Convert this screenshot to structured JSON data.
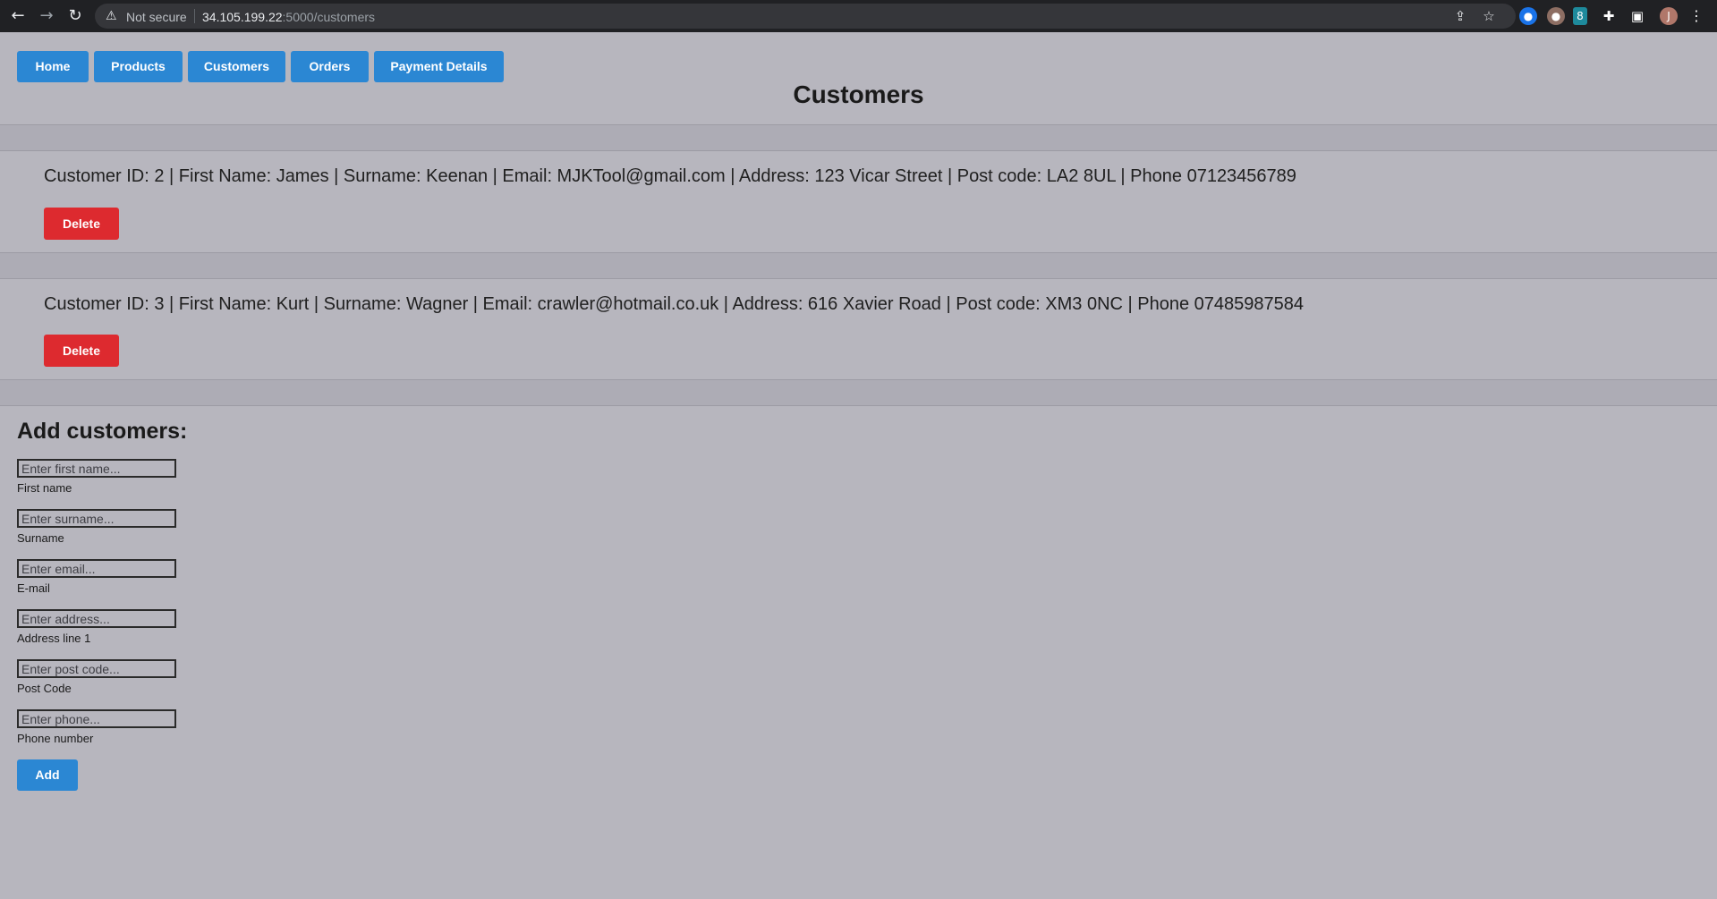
{
  "browser": {
    "security_label": "Not secure",
    "host": "34.105.199.22",
    "path": ":5000/customers",
    "avatar_letter": "J"
  },
  "nav": {
    "home": "Home",
    "products": "Products",
    "customers": "Customers",
    "orders": "Orders",
    "payment_details": "Payment Details"
  },
  "page_title": "Customers",
  "customers": [
    {
      "text": "Customer ID: 2 | First Name: James | Surname: Keenan | Email: MJKTool@gmail.com | Address: 123 Vicar Street | Post code: LA2 8UL | Phone 07123456789",
      "delete_label": "Delete"
    },
    {
      "text": "Customer ID: 3 | First Name: Kurt | Surname: Wagner | Email: crawler@hotmail.co.uk | Address: 616 Xavier Road | Post code: XM3 0NC | Phone 07485987584",
      "delete_label": "Delete"
    }
  ],
  "add_form": {
    "heading": "Add customers:",
    "fields": [
      {
        "placeholder": "Enter first name...",
        "label": "First name",
        "value": ""
      },
      {
        "placeholder": "Enter surname...",
        "label": "Surname",
        "value": ""
      },
      {
        "placeholder": "Enter email...",
        "label": "E-mail",
        "value": ""
      },
      {
        "placeholder": "Enter address...",
        "label": "Address line 1",
        "value": ""
      },
      {
        "placeholder": "Enter post code...",
        "label": "Post Code",
        "value": ""
      },
      {
        "placeholder": "Enter phone...",
        "label": "Phone number",
        "value": ""
      }
    ],
    "submit_label": "Add"
  },
  "colors": {
    "page_bg": "#b7b6be",
    "nav_button": "#2b87d3",
    "delete_button": "#dd2a2f"
  },
  "icons": [
    "back-arrow-icon",
    "forward-arrow-icon",
    "reload-icon",
    "warning-icon",
    "share-icon",
    "star-icon",
    "extension-icon",
    "sidebar-icon",
    "menu-icon"
  ]
}
